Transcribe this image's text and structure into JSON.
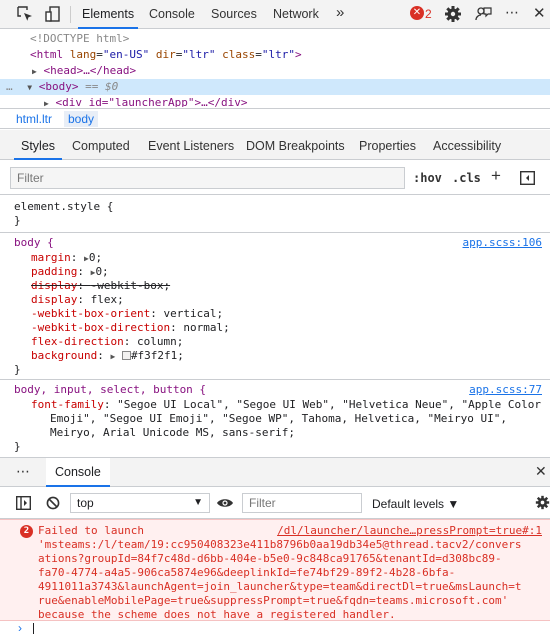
{
  "toolbar": {
    "tabs": [
      "Elements",
      "Console",
      "Sources",
      "Network"
    ],
    "more": "»",
    "error_count": "2"
  },
  "tree": {
    "doctype": "<!DOCTYPE html>",
    "html_open": "<html",
    "lang_attr": "lang",
    "lang_val": "\"en-US\"",
    "dir_attr": "dir",
    "dir_val": "\"ltr\"",
    "class_attr": "class",
    "class_val": "\"ltr\"",
    "head": "<head>…</head>",
    "body_dots": "…",
    "body": "<body>",
    "body_eq": "== $0",
    "div": "<div id=\"launcherApp\">…</div>"
  },
  "breadcrumb": [
    "html.ltr",
    "body"
  ],
  "subtabs": [
    "Styles",
    "Computed",
    "Event Listeners",
    "DOM Breakpoints",
    "Properties",
    "Accessibility"
  ],
  "filter": {
    "placeholder": "Filter",
    "hov": ":hov",
    "cls": ".cls",
    "plus": "+"
  },
  "styles": {
    "element_style": "element.style {",
    "close": "}",
    "body_selector": "body {",
    "body_source": "app.scss:106",
    "body_props": [
      {
        "name": "margin",
        "value": "0;"
      },
      {
        "name": "padding",
        "value": "0;"
      },
      {
        "name": "display",
        "value": "-webkit-box;"
      },
      {
        "name": "display",
        "value": "flex;"
      },
      {
        "name": "-webkit-box-orient",
        "value": "vertical;"
      },
      {
        "name": "-webkit-box-direction",
        "value": "normal;"
      },
      {
        "name": "flex-direction",
        "value": "column;"
      },
      {
        "name": "background",
        "value": "#f3f2f1;"
      }
    ],
    "font_selector": "body, input, select, button {",
    "font_source": "app.scss:77",
    "font_prop": "font-family",
    "font_lines": [
      "\"Segoe UI Local\", \"Segoe UI Web\", \"Helvetica Neue\", \"Apple Color",
      "Emoji\", \"Segoe UI Emoji\", \"Segoe WP\", Tahoma, Helvetica, \"Meiryo UI\",",
      "Meiryo, Arial Unicode MS, sans-serif;"
    ]
  },
  "drawer": {
    "tab": "Console",
    "context": "top",
    "filter_placeholder": "Filter",
    "levels": "Default levels ▼"
  },
  "console_error": {
    "count": "2",
    "source": "/dl/launcher/launche…pressPrompt=true#:1",
    "lines": [
      "Failed to launch",
      "'msteams:/l/team/19:cc950408323e411b8796b0aa19db34e5@thread.tacv2/convers",
      "ations?groupId=84f7c48d-d6bb-404e-b5e0-9c848ca91765&tenantId=d308bc89-",
      "fa70-4774-a4a5-906ca5874e96&deeplinkId=fe74bf29-89f2-4b28-6bfa-",
      "4911011a3743&launchAgent=join_launcher&type=team&directDl=true&msLaunch=t",
      "rue&enableMobilePage=true&suppressPrompt=true&fqdn=teams.microsoft.com'",
      "because the scheme does not have a registered handler."
    ]
  },
  "colors": {
    "accent": "#1a73e8",
    "error": "#d93025",
    "tag": "#881280",
    "prop": "#c80000"
  }
}
